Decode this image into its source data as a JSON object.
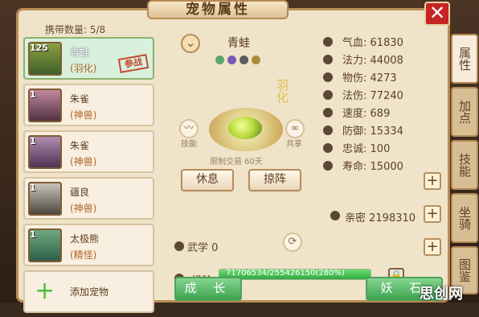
{
  "window": {
    "title": "宠物属性",
    "close_label": "✕"
  },
  "carry": {
    "label": "携带数量: 5/8"
  },
  "pets": [
    {
      "level": "125",
      "name": "青蛙",
      "type": "(羽化)",
      "status": "参战"
    },
    {
      "level": "1",
      "name": "朱雀",
      "type": "(神兽)"
    },
    {
      "level": "1",
      "name": "朱雀",
      "type": "(神兽)"
    },
    {
      "level": "1",
      "name": "疆良",
      "type": "(神兽)"
    },
    {
      "level": "1",
      "name": "太极熊",
      "type": "(精怪)"
    },
    {
      "name": "添加宠物"
    }
  ],
  "selected": {
    "name": "青蛙",
    "stage": "羽化",
    "trade_lock": "限制交易 60天",
    "left_icon_label": "技能",
    "right_icon_label": "共享"
  },
  "buttons": {
    "rest": "休息",
    "attack_formation": "掠阵",
    "growth": "成 长",
    "demon_stone": "妖 石"
  },
  "skill": {
    "label": "武学 0"
  },
  "exp": {
    "label": "经验",
    "bar_text": "71706534/255426150(280%)",
    "fill": 1.0
  },
  "stats": [
    {
      "name": "气血:",
      "value": "61830"
    },
    {
      "name": "法力:",
      "value": "44008"
    },
    {
      "name": "物伤:",
      "value": "4273"
    },
    {
      "name": "法伤:",
      "value": "77240"
    },
    {
      "name": "速度:",
      "value": "689"
    },
    {
      "name": "防御:",
      "value": "15334"
    },
    {
      "name": "忠诚:",
      "value": "100"
    },
    {
      "name": "寿命:",
      "value": "15000"
    }
  ],
  "intimacy": {
    "label": "亲密 2198310"
  },
  "tabs": [
    "属性",
    "加点",
    "技能",
    "坐骑",
    "图鉴"
  ],
  "watermark": "思创网",
  "colors": {
    "accent": "#b98d55",
    "green": "#3ea451",
    "red": "#c62424"
  }
}
